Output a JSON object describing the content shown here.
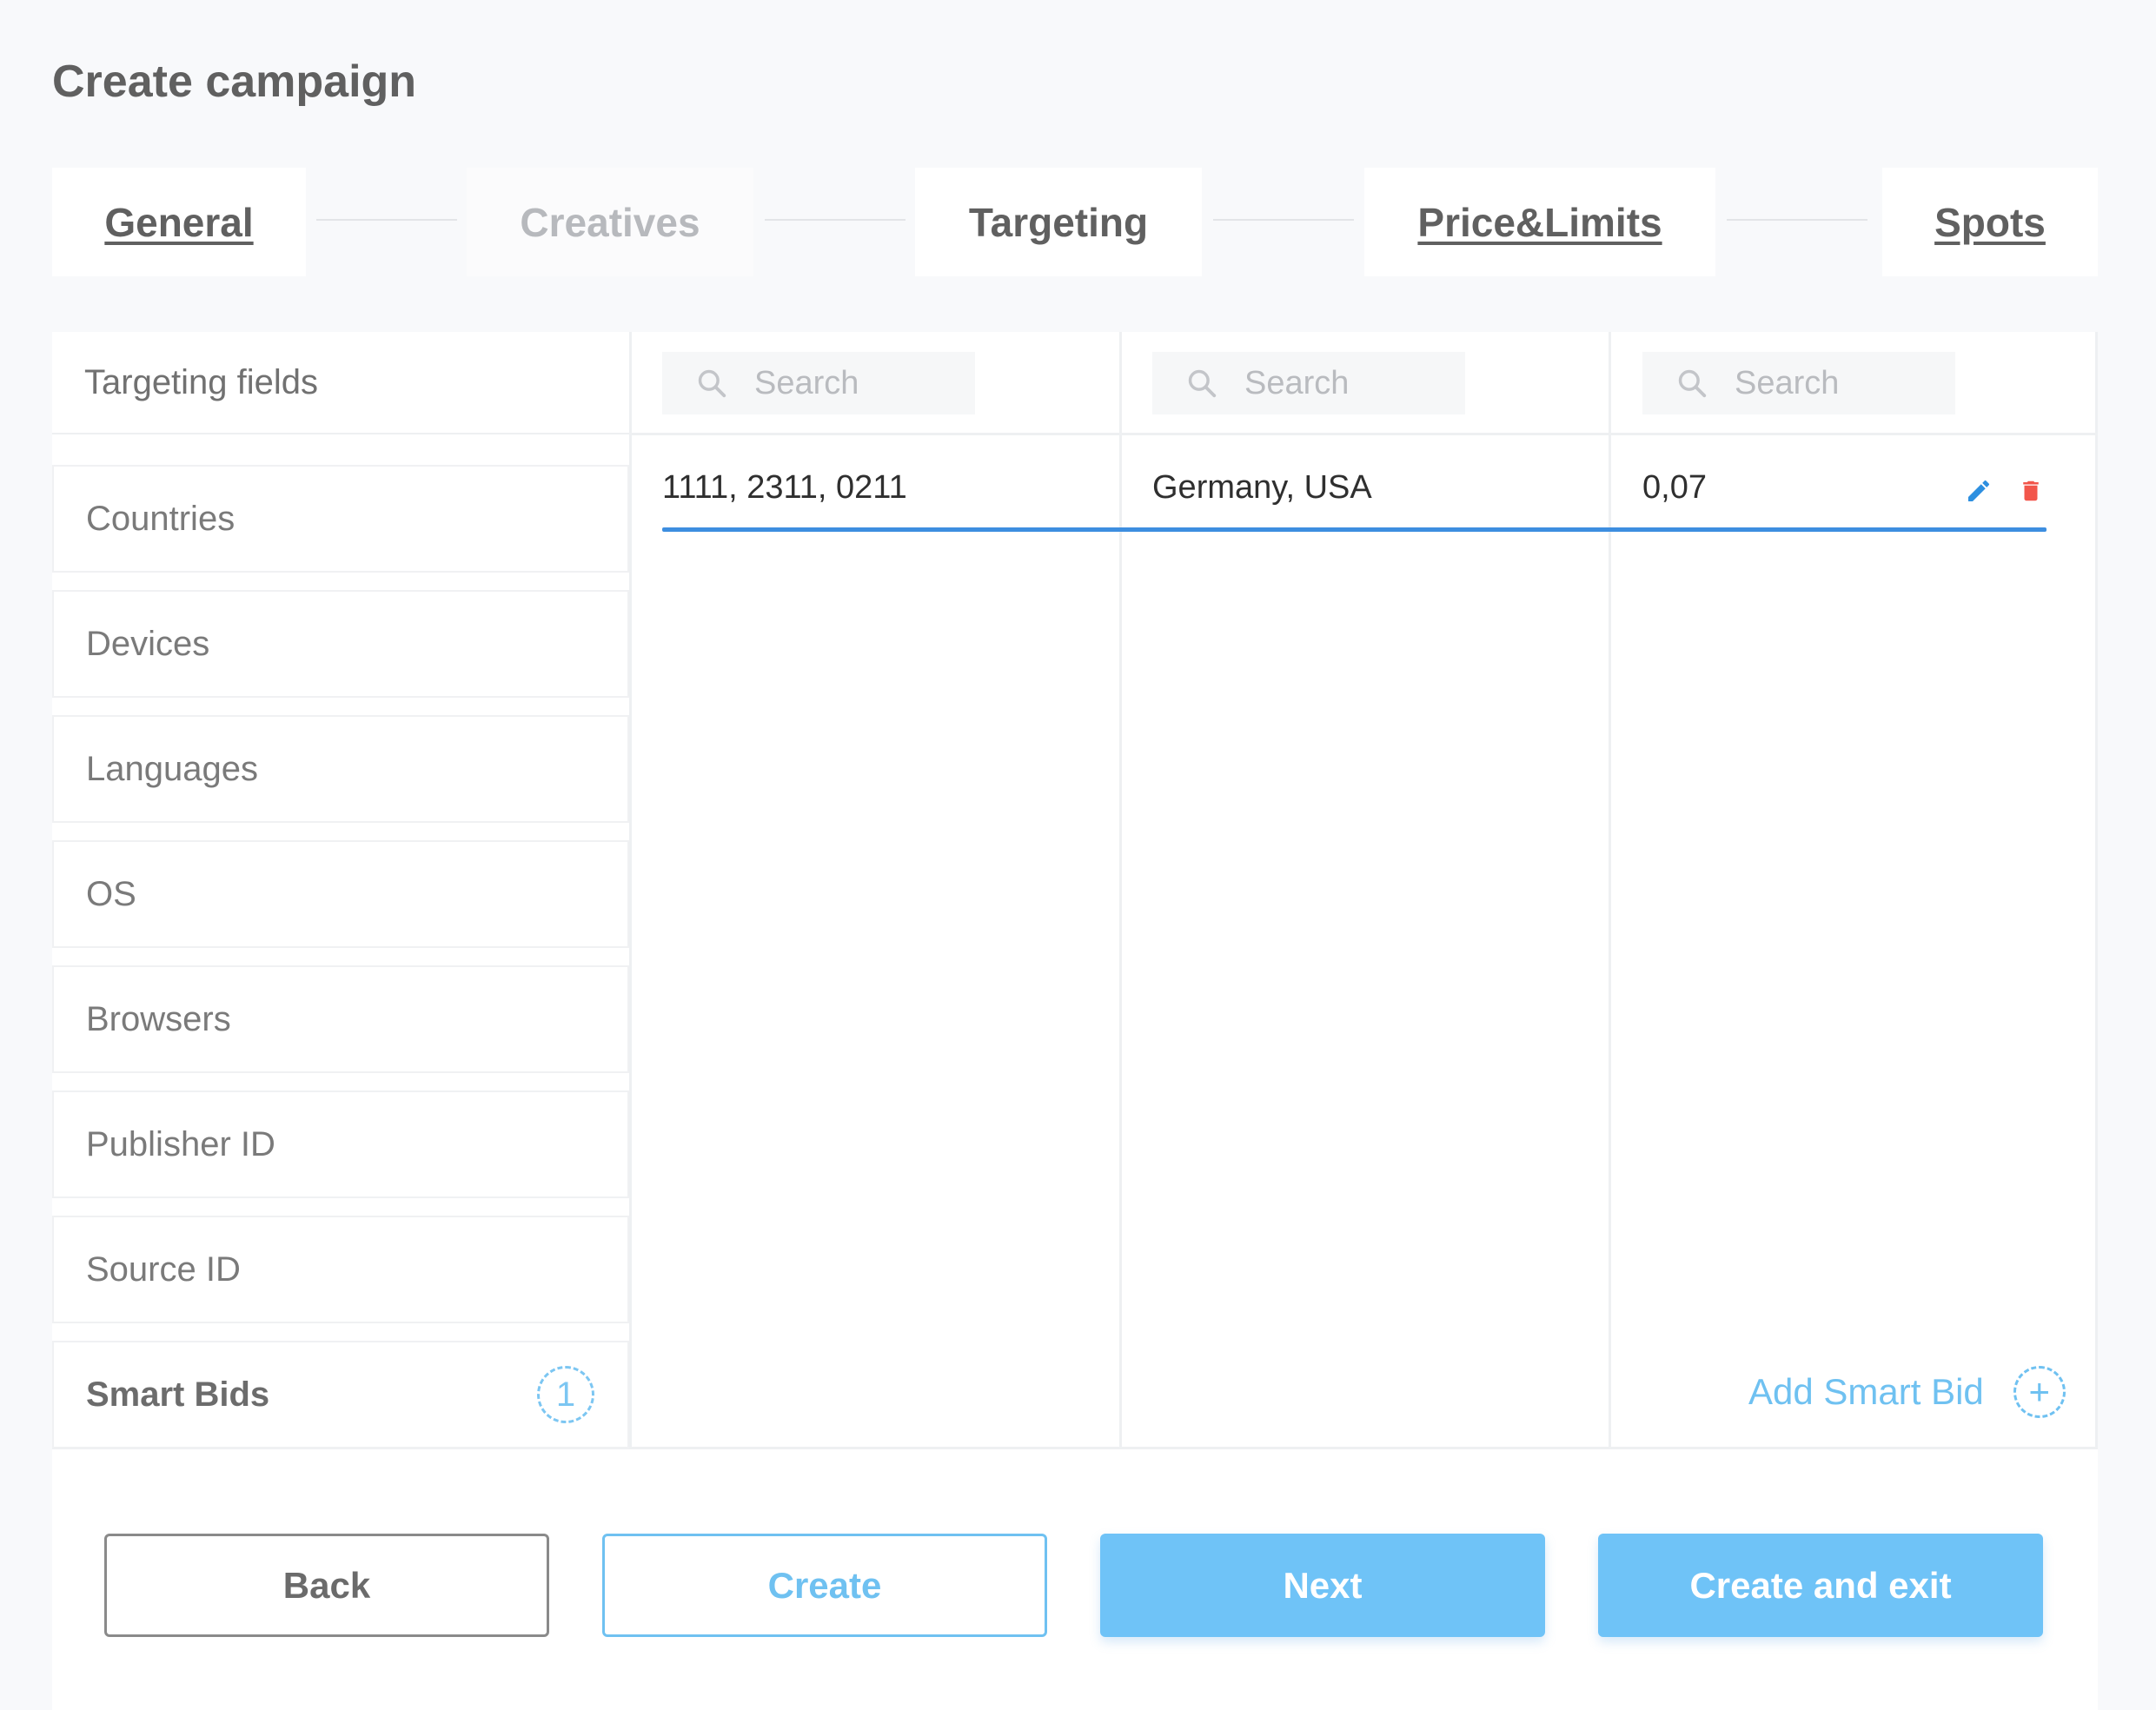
{
  "page": {
    "title": "Create campaign"
  },
  "steps": [
    {
      "label": "General"
    },
    {
      "label": "Creatives"
    },
    {
      "label": "Targeting"
    },
    {
      "label": "Price&Limits"
    },
    {
      "label": "Spots"
    }
  ],
  "fields": {
    "header": "Targeting fields",
    "items": [
      "Countries",
      "Devices",
      "Languages",
      "OS",
      "Browsers",
      "Publisher ID",
      "Source ID"
    ],
    "smart_bids": {
      "label": "Smart Bids",
      "count": "1"
    }
  },
  "columns": [
    {
      "search_placeholder": "Search"
    },
    {
      "search_placeholder": "Search"
    },
    {
      "search_placeholder": "Search"
    }
  ],
  "rows": [
    {
      "col1": "1111, 2311, 0211",
      "col2": "Germany, USA",
      "col3": "0,07"
    }
  ],
  "add_smart_bid": {
    "label": "Add Smart Bid",
    "icon": "plus-icon"
  },
  "buttons": {
    "back": "Back",
    "create": "Create",
    "next": "Next",
    "create_exit": "Create and exit"
  },
  "colors": {
    "accent": "#6fc3f7",
    "row_underline": "#3d8ee0",
    "edit_icon": "#2d8fe0",
    "delete_icon": "#f2564b"
  }
}
